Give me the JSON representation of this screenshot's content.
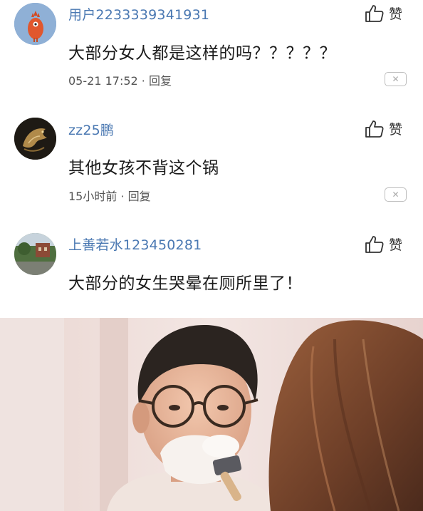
{
  "comments": [
    {
      "username": "用户2233339341931",
      "text": "大部分女人都是这样的吗？？？？？",
      "time": "05-21 17:52",
      "separator": "·",
      "reply_label": "回复",
      "like_label": "赞",
      "avatar_icon": "chicken-icon",
      "avatar_color": "#7a9cc6"
    },
    {
      "username": "zz25鹏",
      "text": "其他女孩不背这个锅",
      "time": "15小时前",
      "separator": "·",
      "reply_label": "回复",
      "like_label": "赞",
      "avatar_icon": "dragon-icon",
      "avatar_color": "#1e1a14"
    },
    {
      "username": "上善若水123450281",
      "text": "大部分的女生哭晕在厕所里了！",
      "like_label": "赞",
      "avatar_icon": "landscape-icon",
      "avatar_color": "#5f7a52"
    }
  ],
  "colors": {
    "username": "#4a78b2",
    "text": "#1a1a1a",
    "meta": "#555555"
  }
}
